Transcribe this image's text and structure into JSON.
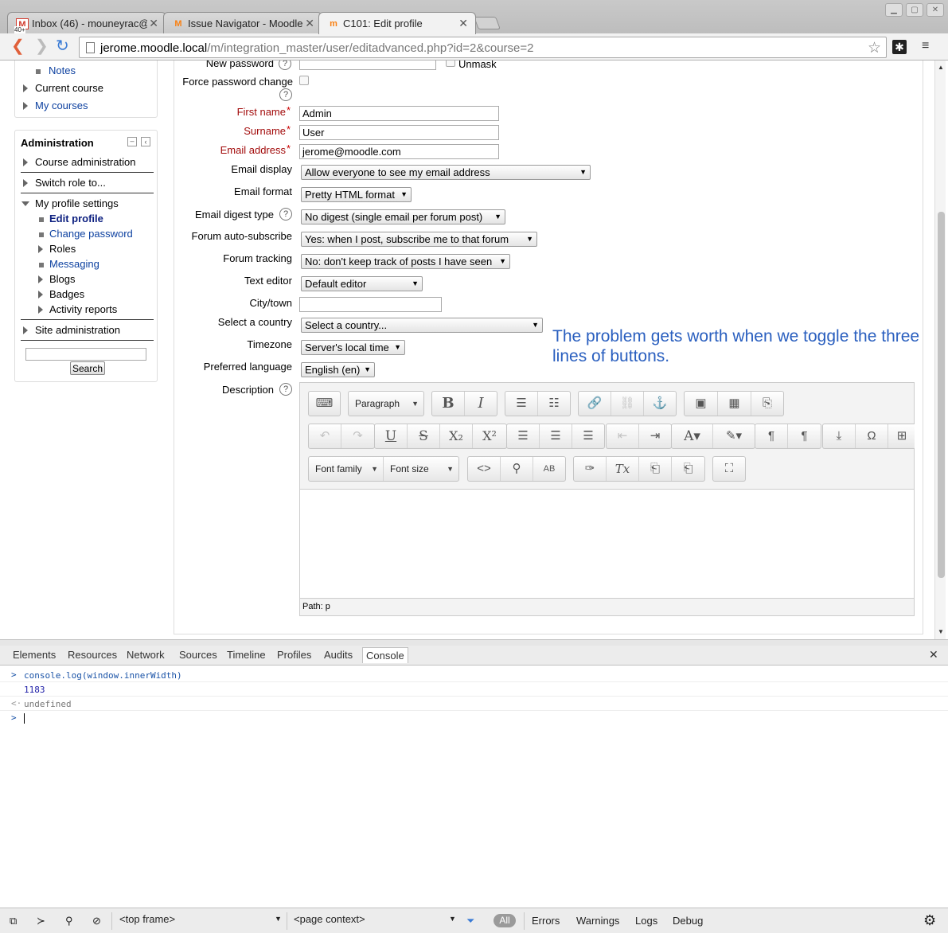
{
  "browser": {
    "tabs": [
      {
        "title": "Inbox (46) - mouneyrac@g",
        "favicon": "gmail-icon"
      },
      {
        "title": "Issue Navigator - Moodle T",
        "favicon": "moodle-icon"
      },
      {
        "title": "C101: Edit profile",
        "favicon": "moodle-hat-icon"
      }
    ],
    "gmail_badge": "40+",
    "url_host": "jerome.moodle.local",
    "url_path": "/m/integration_master/user/editadvanced.php?id=2&course=2"
  },
  "sidebar": {
    "nav_items": [
      "Notes",
      "Current course",
      "My courses"
    ],
    "admin_title": "Administration",
    "admin_items": {
      "course_admin": "Course administration",
      "switch_role": "Switch role to...",
      "profile_settings": "My profile settings",
      "edit_profile": "Edit profile",
      "change_password": "Change password",
      "roles": "Roles",
      "messaging": "Messaging",
      "blogs": "Blogs",
      "badges": "Badges",
      "activity_reports": "Activity reports",
      "site_admin": "Site administration"
    },
    "search_label": "Search"
  },
  "form": {
    "new_password_label": "New password",
    "unmask_label": "Unmask",
    "force_password_label": "Force password change",
    "first_name_label": "First name",
    "first_name_value": "Admin",
    "surname_label": "Surname",
    "surname_value": "User",
    "email_label": "Email address",
    "email_value": "jerome@moodle.com",
    "email_display_label": "Email display",
    "email_display_value": "Allow everyone to see my email address",
    "email_format_label": "Email format",
    "email_format_value": "Pretty HTML format",
    "email_digest_label": "Email digest type",
    "email_digest_value": "No digest (single email per forum post)",
    "forum_autosub_label": "Forum auto-subscribe",
    "forum_autosub_value": "Yes: when I post, subscribe me to that forum",
    "forum_tracking_label": "Forum tracking",
    "forum_tracking_value": "No: don't keep track of posts I have seen",
    "text_editor_label": "Text editor",
    "text_editor_value": "Default editor",
    "city_label": "City/town",
    "city_value": "",
    "country_label": "Select a country",
    "country_value": "Select a country...",
    "timezone_label": "Timezone",
    "timezone_value": "Server's local time",
    "language_label": "Preferred language",
    "language_value": "English (en)",
    "description_label": "Description",
    "required_mark": "*",
    "help_mark": "?"
  },
  "annotation": "The problem gets worth when we toggle the three lines of buttons.",
  "editor": {
    "format_value": "Paragraph",
    "font_family_label": "Font family",
    "font_size_label": "Font size",
    "path_label": "Path: p"
  },
  "devtools": {
    "tabs": [
      "Elements",
      "Resources",
      "Network",
      "Sources",
      "Timeline",
      "Profiles",
      "Audits",
      "Console"
    ],
    "active_tab": "Console",
    "console_lines": [
      {
        "prefix": ">",
        "text": "console.log(window.innerWidth)",
        "color": "#1a53a7"
      },
      {
        "prefix": "",
        "text": "1183",
        "color": "#1a1aa6"
      },
      {
        "prefix": "<·",
        "text": "undefined",
        "color": "#777777"
      },
      {
        "prefix": ">",
        "text": "",
        "color": "#1a53a7"
      }
    ],
    "frame_select": "<top frame>",
    "context_select": "<page context>",
    "filter_all": "All",
    "filters": [
      "Errors",
      "Warnings",
      "Logs",
      "Debug"
    ]
  },
  "colors": {
    "link": "#0d41a0",
    "required": "#a20b0b",
    "annotation": "#2a5fbf"
  }
}
